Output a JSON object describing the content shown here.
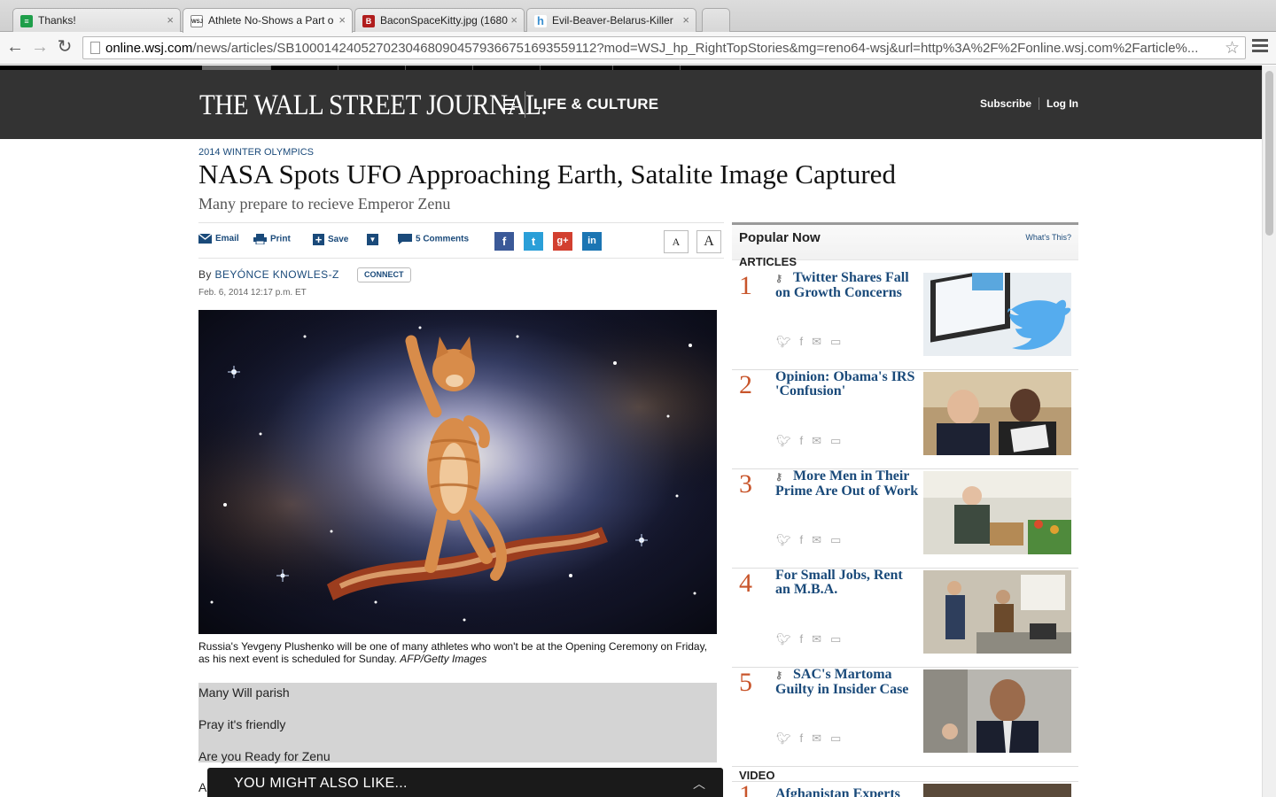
{
  "browser": {
    "tabs": [
      {
        "title": "Thanks!",
        "favicon_color": "#1e9e4a",
        "favicon_glyph": "≡"
      },
      {
        "title": "Athlete No-Shows a Part o",
        "favicon_color": "#666666",
        "favicon_glyph": "WSJ"
      },
      {
        "title": "BaconSpaceKitty.jpg (1680",
        "favicon_color": "#b01c1c",
        "favicon_glyph": "B"
      },
      {
        "title": "Evil-Beaver-Belarus-Killer",
        "favicon_color": "#3a8fd0",
        "favicon_glyph": "h"
      }
    ],
    "url_host": "online.wsj.com",
    "url_rest": "/news/articles/SB10001424052702304680904579366751693559112?mod=WSJ_hp_RightTopStories&mg=reno64-wsj&url=http%3A%2F%2Fonline.wsj.com%2Farticle%..."
  },
  "masthead": {
    "logo": "THE WALL STREET JOURNAL.",
    "section": "LIFE & CULTURE",
    "subscribe": "Subscribe",
    "login": "Log In"
  },
  "article": {
    "kicker": "2014 WINTER OLYMPICS",
    "headline": "NASA Spots UFO Approaching Earth, Satalite Image Captured",
    "dek": "Many prepare to recieve Emperor Zenu",
    "share": {
      "email": "Email",
      "print": "Print",
      "save": "Save",
      "comments": "5 Comments",
      "font_small": "A",
      "font_large": "A"
    },
    "byline_prefix": "By",
    "author": "BEYÓNCE KNOWLES-Z",
    "connect": "CONNECT",
    "date": "Feb. 6, 2014 12:17 p.m. ET",
    "caption": "Russia's Yevgeny Plushenko will be one of many athletes who won't be at the Opening Ceremony on Friday, as his next event is scheduled for Sunday.",
    "credit": "AFP/Getty Images",
    "body_lines": [
      "Many Will parish",
      "Pray it's friendly",
      "Are you Ready for Zenu"
    ],
    "cut_text": "A"
  },
  "you_might_also_like": "YOU MIGHT ALSO LIKE...",
  "sidebar": {
    "title": "Popular Now",
    "whats_this": "What's This?",
    "articles_label": "ARTICLES",
    "items": [
      {
        "num": "1",
        "title": "Twitter Shares Fall on Growth Concerns",
        "key": true
      },
      {
        "num": "2",
        "title": "Opinion: Obama's IRS 'Confusion'",
        "key": false
      },
      {
        "num": "3",
        "title": "More Men in Their Prime Are Out of Work",
        "key": true
      },
      {
        "num": "4",
        "title": "For Small Jobs, Rent an M.B.A.",
        "key": false
      },
      {
        "num": "5",
        "title": "SAC's Martoma Guilty in Insider Case",
        "key": true
      }
    ],
    "video_label": "VIDEO",
    "video_item": {
      "num": "1",
      "title": "Afghanistan Experts"
    }
  },
  "colors": {
    "accent_blue": "#1a4a7a",
    "number_orange": "#c8552b",
    "masthead_bg": "#333333"
  }
}
